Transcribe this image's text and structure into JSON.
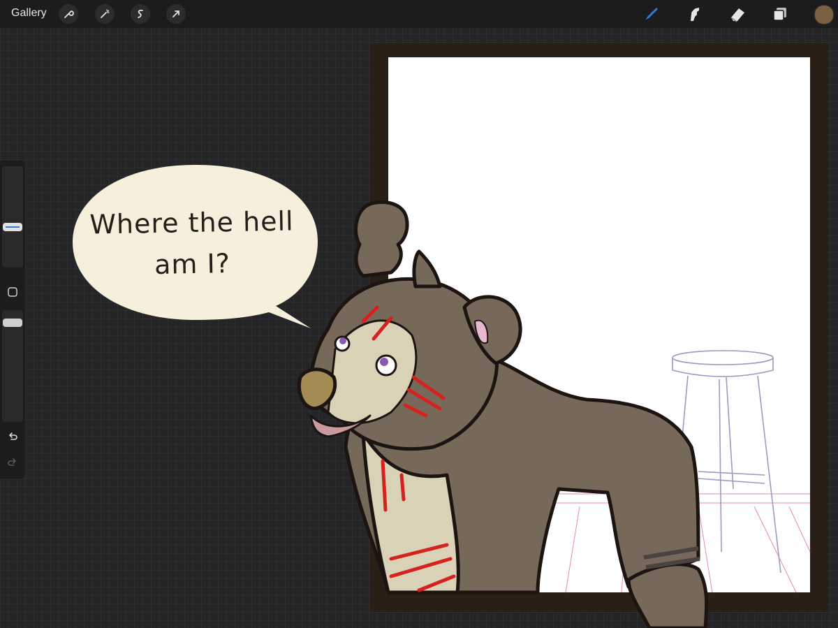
{
  "toolbar": {
    "gallery_label": "Gallery",
    "left_tools": [
      {
        "name": "wrench-icon"
      },
      {
        "name": "magic-wand-icon"
      },
      {
        "name": "selection-icon"
      },
      {
        "name": "transform-arrow-icon"
      }
    ],
    "right_tools": [
      {
        "name": "brush-icon",
        "active": true
      },
      {
        "name": "smudge-icon",
        "active": false
      },
      {
        "name": "eraser-icon",
        "active": false
      },
      {
        "name": "layers-icon",
        "active": false
      }
    ],
    "current_color": "#7a6043",
    "active_tool_color": "#2f7de1"
  },
  "sidebar": {
    "brush_size_label": "brush size",
    "opacity_label": "opacity",
    "modify_button": "modify",
    "undo": "undo",
    "redo": "redo"
  },
  "artwork": {
    "speech_line1": "Where the hell",
    "speech_line2": "am I?"
  },
  "colors": {
    "frame": "#2a1f16",
    "bubble": "#f5efdc",
    "fur": "#77695a",
    "fur_light": "#d9d2b7",
    "scratch": "#d5221f"
  }
}
